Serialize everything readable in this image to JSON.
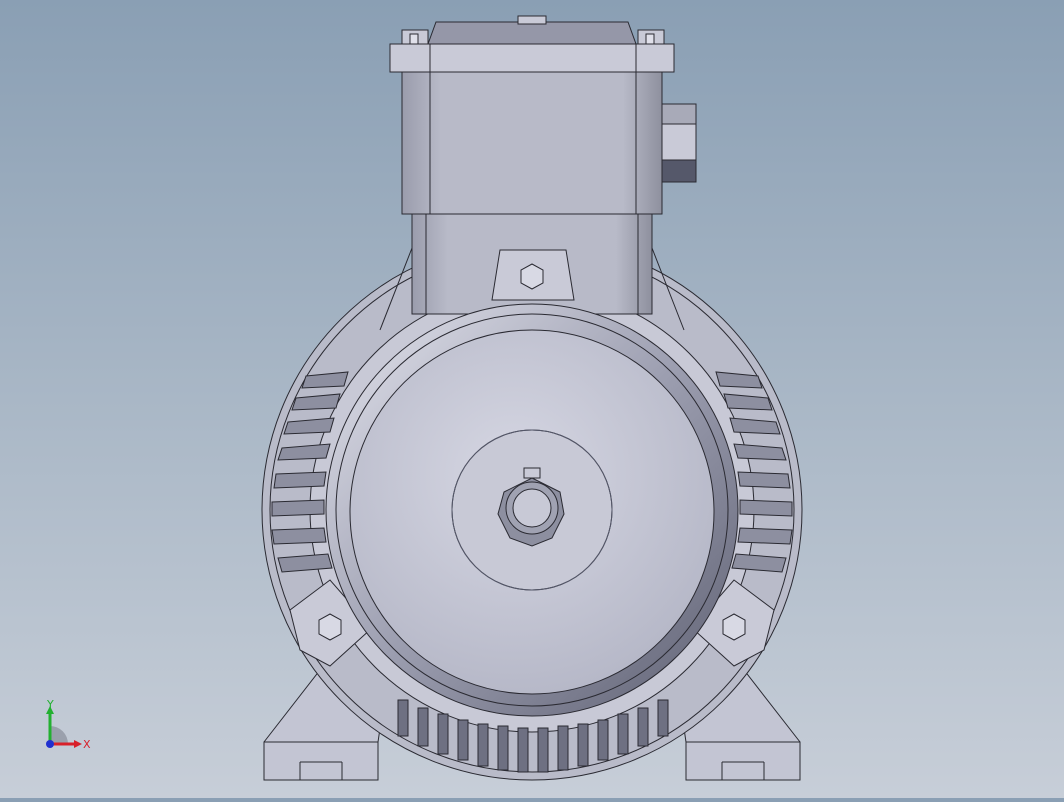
{
  "viewport": {
    "model": "motor-front-view",
    "background_top": "#8a9fb4",
    "background_bottom": "#c7ced8",
    "body_color": "#c3c5d3",
    "edge_color": "#2a2a32"
  },
  "triad": {
    "x_label": "X",
    "y_label": "Y",
    "x_color": "#d8202a",
    "y_color": "#22b030",
    "z_color": "#2030d0"
  }
}
